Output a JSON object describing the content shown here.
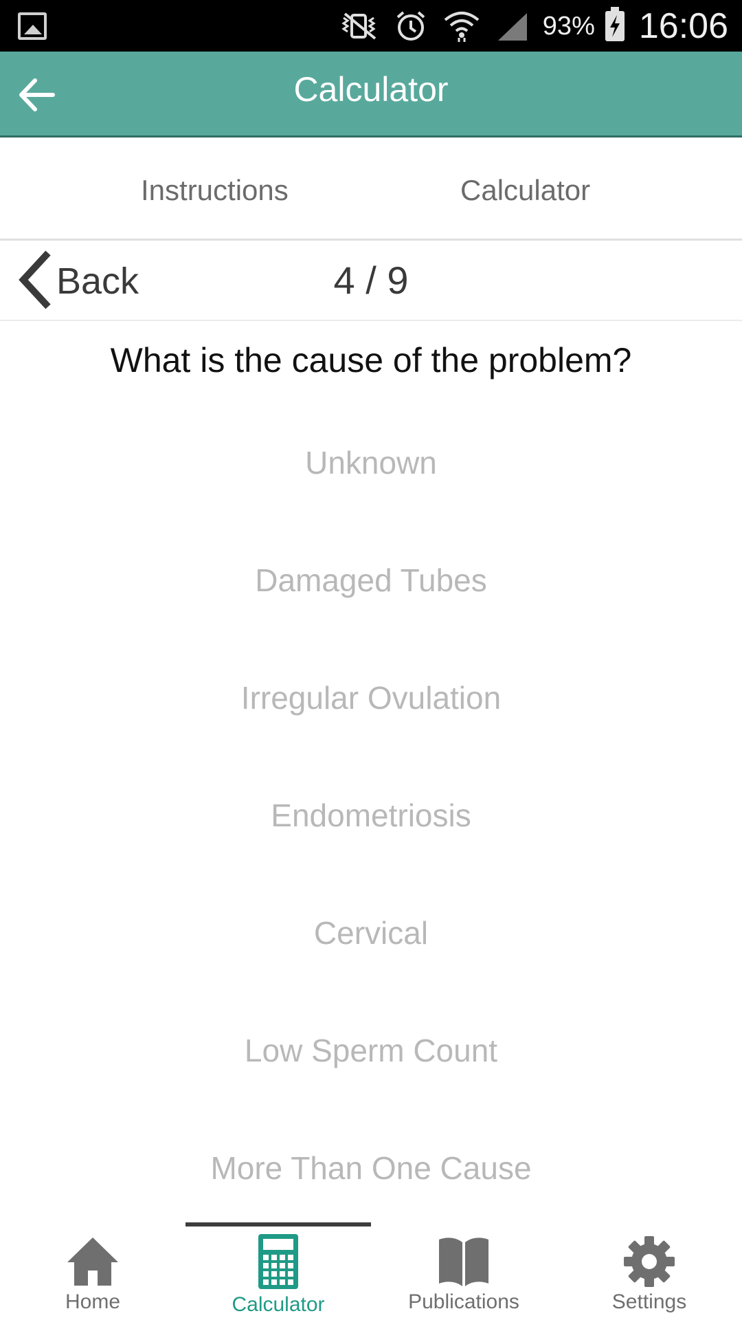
{
  "status_bar": {
    "battery_percent": "93%",
    "time": "16:06",
    "icons": [
      "gallery-icon",
      "vibrate-mute-icon",
      "alarm-icon",
      "wifi-icon",
      "cell-signal-icon",
      "battery-charging-icon"
    ]
  },
  "app_bar": {
    "title": "Calculator"
  },
  "tabs": [
    {
      "label": "Instructions"
    },
    {
      "label": "Calculator"
    }
  ],
  "step_nav": {
    "back_label": "Back",
    "progress": "4 / 9"
  },
  "question": "What is the cause of the problem?",
  "answers": [
    {
      "label": "Unknown"
    },
    {
      "label": "Damaged Tubes"
    },
    {
      "label": "Irregular Ovulation"
    },
    {
      "label": "Endometriosis"
    },
    {
      "label": "Cervical"
    },
    {
      "label": "Low Sperm Count"
    },
    {
      "label": "More Than One Cause"
    }
  ],
  "bottom_nav": {
    "active": "Calculator",
    "items": [
      {
        "label": "Home",
        "icon": "home-icon"
      },
      {
        "label": "Calculator",
        "icon": "calculator-icon"
      },
      {
        "label": "Publications",
        "icon": "book-icon"
      },
      {
        "label": "Settings",
        "icon": "gear-icon"
      }
    ]
  },
  "colors": {
    "app_bar": "#58a99c",
    "active_nav": "#1f9a86",
    "answer_text": "#b8b8b8"
  }
}
